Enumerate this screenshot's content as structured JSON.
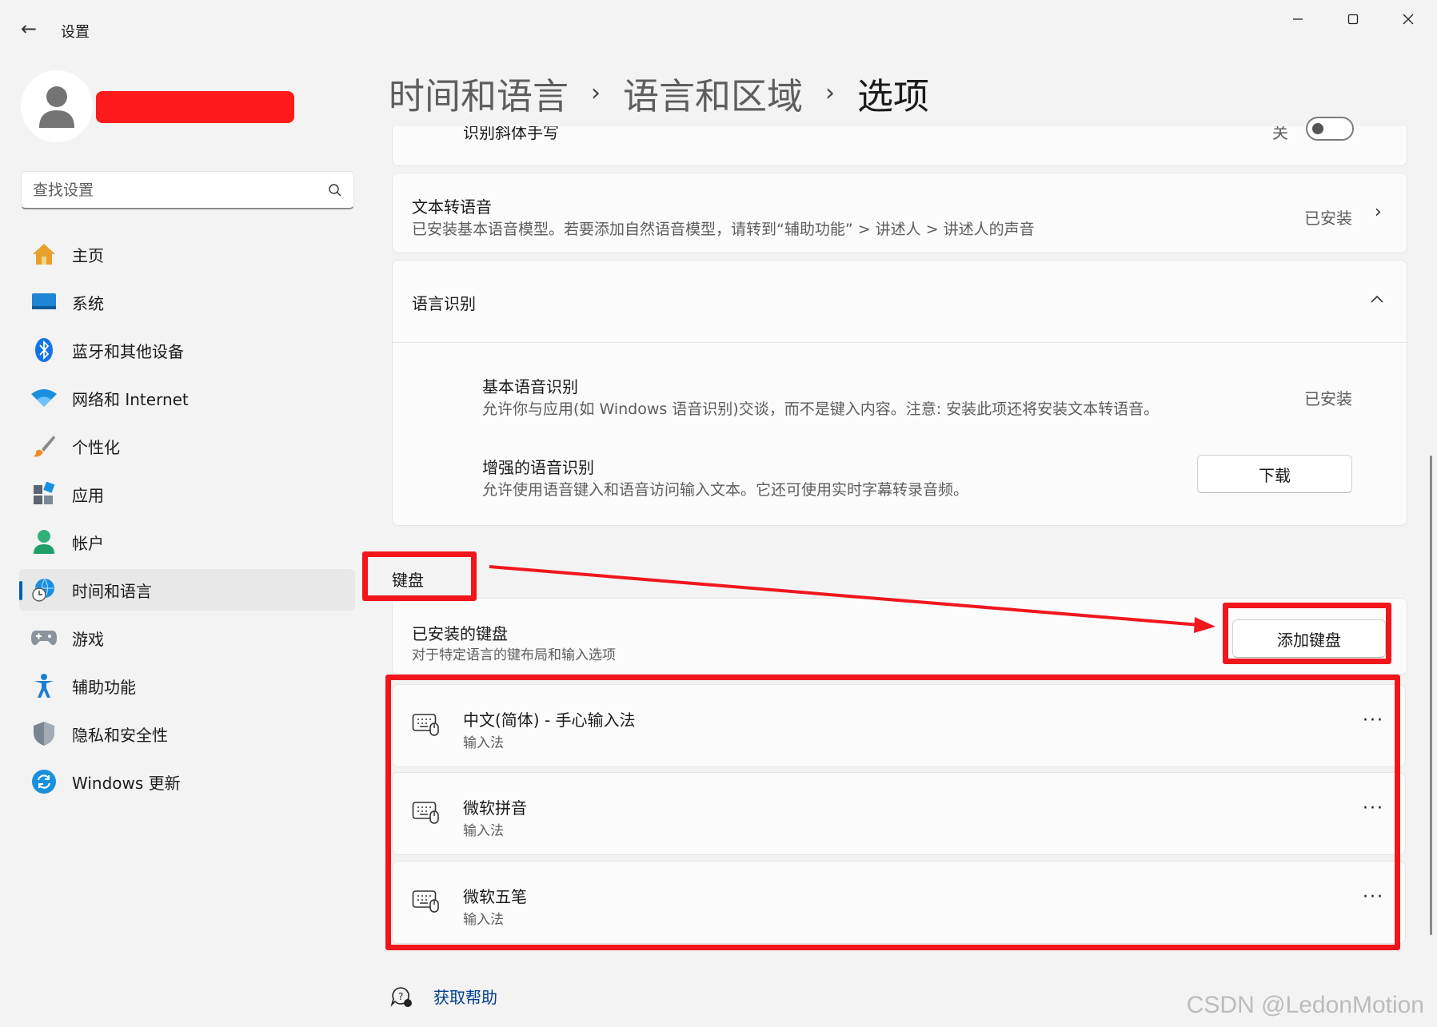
{
  "window": {
    "title": "设置",
    "back_glyph": "←",
    "minimize_glyph": "—",
    "maximize_glyph": "☐",
    "close_glyph": "✕"
  },
  "search": {
    "placeholder": "查找设置"
  },
  "nav": {
    "items": [
      {
        "label": "主页",
        "icon": "home-icon"
      },
      {
        "label": "系统",
        "icon": "display-icon"
      },
      {
        "label": "蓝牙和其他设备",
        "icon": "bluetooth-icon"
      },
      {
        "label": "网络和 Internet",
        "icon": "wifi-icon"
      },
      {
        "label": "个性化",
        "icon": "brush-icon"
      },
      {
        "label": "应用",
        "icon": "apps-icon"
      },
      {
        "label": "帐户",
        "icon": "account-icon"
      },
      {
        "label": "时间和语言",
        "icon": "globe-clock-icon",
        "active": true
      },
      {
        "label": "游戏",
        "icon": "gamepad-icon"
      },
      {
        "label": "辅助功能",
        "icon": "accessibility-icon"
      },
      {
        "label": "隐私和安全性",
        "icon": "shield-icon"
      },
      {
        "label": "Windows 更新",
        "icon": "update-icon"
      }
    ]
  },
  "breadcrumb": {
    "items": [
      "时间和语言",
      "语言和区域",
      "选项"
    ],
    "separator": "›"
  },
  "main": {
    "handwriting_row": {
      "title": "识别斜体手写",
      "toggle_label": "关",
      "toggle_on": false
    },
    "tts": {
      "title": "文本转语音",
      "desc": "已安装基本语音模型。若要添加自然语音模型，请转到“辅助功能” > 讲述人 > 讲述人的声音",
      "status": "已安装",
      "chevron": "›"
    },
    "speech": {
      "title": "语言识别",
      "collapse_glyph": "︿",
      "basic": {
        "title": "基本语音识别",
        "desc": "允许你与应用(如 Windows 语音识别)交谈，而不是键入内容。注意: 安装此项还将安装文本转语音。",
        "status": "已安装"
      },
      "enhanced": {
        "title": "增强的语音识别",
        "desc": "允许使用语音键入和语音访问输入文本。它还可使用实时字幕转录音频。",
        "button": "下载"
      }
    },
    "keyboard": {
      "section_label": "键盘",
      "installed_title": "已安装的键盘",
      "installed_desc": "对于特定语言的键布局和输入选项",
      "add_button": "添加键盘",
      "items": [
        {
          "name": "中文(简体) - 手心输入法",
          "sub": "输入法"
        },
        {
          "name": "微软拼音",
          "sub": "输入法"
        },
        {
          "name": "微软五笔",
          "sub": "输入法"
        }
      ],
      "more_glyph": "···"
    },
    "help": {
      "label": "获取帮助"
    }
  },
  "watermark": "CSDN @LedonMotion",
  "colors": {
    "accent": "#005fb8",
    "annotation_red": "#f0161c",
    "link": "#003e92"
  }
}
